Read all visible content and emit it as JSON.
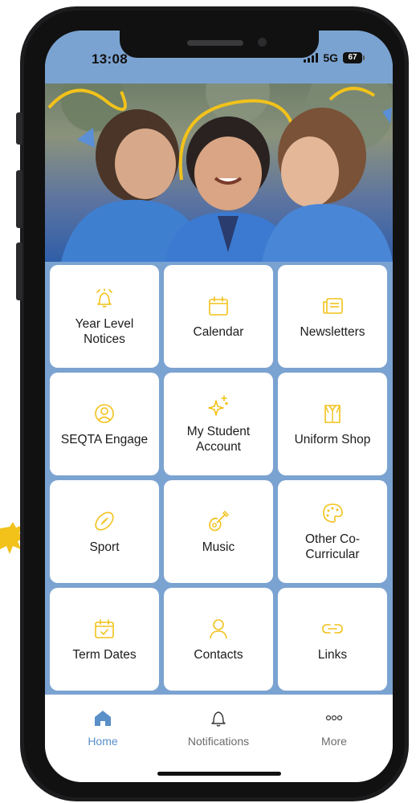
{
  "status": {
    "time": "13:08",
    "network": "5G",
    "battery": "67"
  },
  "tiles": [
    {
      "label": "Year Level\nNotices",
      "icon": "alarm-bell-icon"
    },
    {
      "label": "Calendar",
      "icon": "calendar-icon"
    },
    {
      "label": "Newsletters",
      "icon": "newspaper-icon"
    },
    {
      "label": "SEQTA Engage",
      "icon": "user-circle-icon"
    },
    {
      "label": "My Student\nAccount",
      "icon": "sparkles-icon"
    },
    {
      "label": "Uniform Shop",
      "icon": "shirt-icon"
    },
    {
      "label": "Sport",
      "icon": "football-icon"
    },
    {
      "label": "Music",
      "icon": "guitar-icon"
    },
    {
      "label": "Other Co-\nCurricular",
      "icon": "palette-icon"
    },
    {
      "label": "Term Dates",
      "icon": "calendar-check-icon"
    },
    {
      "label": "Contacts",
      "icon": "person-icon"
    },
    {
      "label": "Links",
      "icon": "link-icon"
    }
  ],
  "tabbar": {
    "home": "Home",
    "notifications": "Notifications",
    "more": "More"
  },
  "colors": {
    "accent": "#f2c21b",
    "active_tab": "#5a8fc8",
    "screen_bg": "#7ba3d1"
  }
}
